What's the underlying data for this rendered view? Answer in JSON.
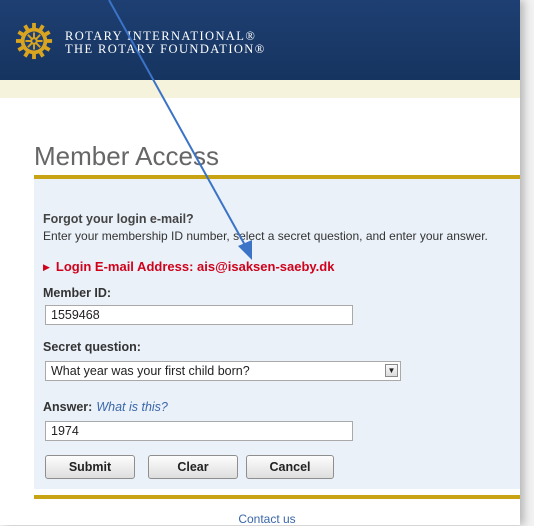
{
  "header": {
    "line1": "ROTARY INTERNATIONAL®",
    "line2": "THE ROTARY FOUNDATION®"
  },
  "page_title": "Member Access",
  "form": {
    "forgot_title": "Forgot your login e-mail?",
    "forgot_text": "Enter your membership ID number, select a secret question, and enter your answer.",
    "login_message": "Login E-mail Address: ais@isaksen-saeby.dk",
    "member_id_label": "Member ID:",
    "member_id_value": "1559468",
    "secret_question_label": "Secret question:",
    "secret_question_value": "What year was your first child born?",
    "answer_label": "Answer:",
    "answer_help_link": "What is this?",
    "answer_value": "1974",
    "submit_label": "Submit",
    "clear_label": "Clear",
    "cancel_label": "Cancel"
  },
  "footer": {
    "contact_link": "Contact us"
  },
  "colors": {
    "header_blue": "#1a3a6a",
    "gold": "#c8a414",
    "error_red": "#d0021b",
    "link_blue": "#3b67a8",
    "panel_bg": "#eaf1f9",
    "annotation_arrow": "#3b73c7"
  },
  "icons": {
    "logo": "rotary-wheel-icon",
    "select_arrow": "chevron-down-icon",
    "message_bullet": "triangle-right-icon"
  }
}
